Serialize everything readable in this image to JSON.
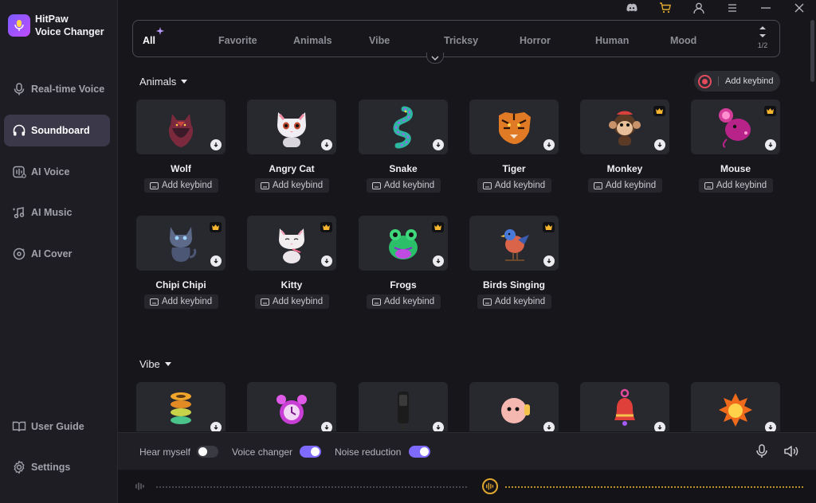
{
  "app": {
    "name_line1": "HitPaw",
    "name_line2": "Voice Changer"
  },
  "colors": {
    "accent": "#7f6aff",
    "record": "#e24b5b",
    "wave_active": "#e0a82e",
    "premium": "#f5b52e"
  },
  "sidebar": {
    "items": [
      {
        "label": "Real-time Voice",
        "icon": "microphone-icon"
      },
      {
        "label": "Soundboard",
        "icon": "headphones-icon",
        "active": true
      },
      {
        "label": "AI Voice",
        "icon": "ai-voice-icon"
      },
      {
        "label": "AI Music",
        "icon": "ai-music-icon"
      },
      {
        "label": "AI Cover",
        "icon": "ai-cover-icon"
      }
    ],
    "bottom": [
      {
        "label": "User Guide",
        "icon": "book-icon"
      },
      {
        "label": "Settings",
        "icon": "gear-icon"
      }
    ]
  },
  "titlebar": {
    "icons": [
      "discord-icon",
      "cart-icon",
      "user-icon",
      "menu-icon",
      "minimize-icon",
      "close-icon"
    ]
  },
  "tabs": {
    "items": [
      "All",
      "Favorite",
      "Animals",
      "Vibe",
      "Tricksy",
      "Horror",
      "Human",
      "Mood"
    ],
    "active": "All",
    "page": "1/2"
  },
  "sections": {
    "animals": {
      "title": "Animals",
      "add_keybind": "Add keybind",
      "cards": [
        {
          "name": "Wolf",
          "keybind": "Add keybind",
          "premium": false,
          "icon": "wolf-icon"
        },
        {
          "name": "Angry Cat",
          "keybind": "Add keybind",
          "premium": false,
          "icon": "cat-icon"
        },
        {
          "name": "Snake",
          "keybind": "Add keybind",
          "premium": false,
          "icon": "snake-icon"
        },
        {
          "name": "Tiger",
          "keybind": "Add keybind",
          "premium": false,
          "icon": "tiger-icon"
        },
        {
          "name": "Monkey",
          "keybind": "Add keybind",
          "premium": true,
          "icon": "monkey-icon"
        },
        {
          "name": "Mouse",
          "keybind": "Add keybind",
          "premium": true,
          "icon": "mouse-icon"
        },
        {
          "name": "Chipi Chipi",
          "keybind": "Add keybind",
          "premium": true,
          "icon": "cat-icon"
        },
        {
          "name": "Kitty",
          "keybind": "Add keybind",
          "premium": true,
          "icon": "kitten-icon"
        },
        {
          "name": "Frogs",
          "keybind": "Add keybind",
          "premium": true,
          "icon": "frog-icon"
        },
        {
          "name": "Birds Singing",
          "keybind": "Add keybind",
          "premium": true,
          "icon": "bird-icon"
        }
      ]
    },
    "vibe": {
      "title": "Vibe",
      "cards": [
        {
          "icon": "spring-icon"
        },
        {
          "icon": "alarm-clock-icon"
        },
        {
          "icon": "speaker-icon"
        },
        {
          "icon": "headphone-blob-icon"
        },
        {
          "icon": "bell-icon"
        },
        {
          "icon": "explosion-icon"
        }
      ]
    }
  },
  "toolbar": {
    "hear_myself": {
      "label": "Hear myself",
      "on": false
    },
    "voice_changer": {
      "label": "Voice changer",
      "on": true
    },
    "noise_reduction": {
      "label": "Noise reduction",
      "on": true
    }
  }
}
